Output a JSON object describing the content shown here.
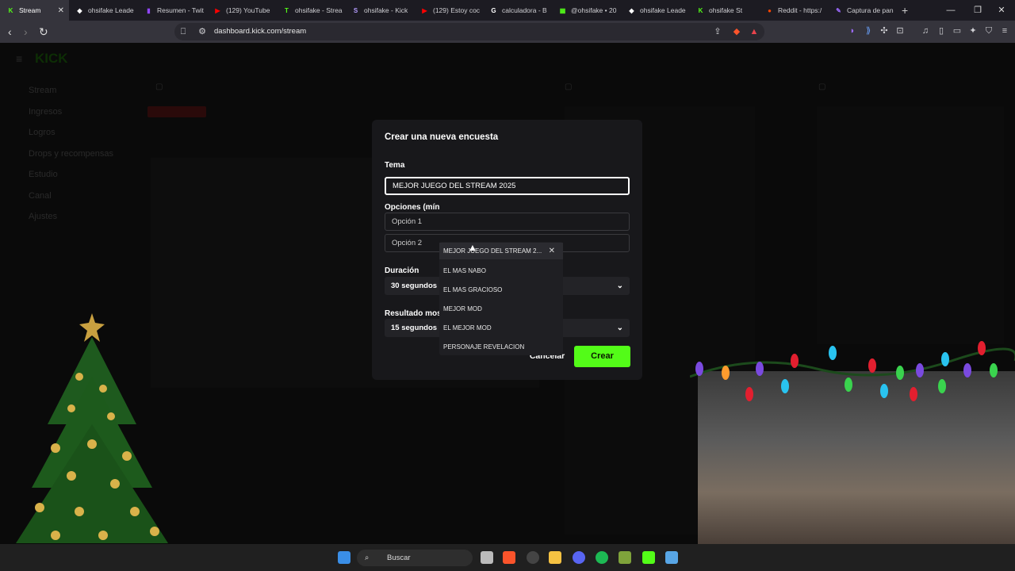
{
  "browser": {
    "tabs": [
      {
        "label": "Stream",
        "color": "#53fc18",
        "glyph": "K",
        "active": true
      },
      {
        "label": "ohsifake Leade",
        "color": "#ffffff",
        "glyph": "◆"
      },
      {
        "label": "Resumen - Twit",
        "color": "#9146ff",
        "glyph": "▮"
      },
      {
        "label": "(129) YouTube",
        "color": "#ff0000",
        "glyph": "▶"
      },
      {
        "label": "ohsifake - Strea",
        "color": "#53fc18",
        "glyph": "T"
      },
      {
        "label": "ohsifake - Kick",
        "color": "#b49cff",
        "glyph": "S"
      },
      {
        "label": "(129) Estoy coc",
        "color": "#ff0000",
        "glyph": "▶"
      },
      {
        "label": "calculadora - B",
        "color": "#ffffff",
        "glyph": "G"
      },
      {
        "label": "@ohsifake • 20",
        "color": "#53fc18",
        "glyph": "▦"
      },
      {
        "label": "ohsifake Leade",
        "color": "#ffffff",
        "glyph": "◆"
      },
      {
        "label": "ohsifake St",
        "color": "#53fc18",
        "glyph": "K"
      },
      {
        "label": "Reddit - https:/",
        "color": "#ff4500",
        "glyph": "●"
      },
      {
        "label": "Captura de pan",
        "color": "#9d6bff",
        "glyph": "✎"
      }
    ],
    "url": "dashboard.kick.com/stream"
  },
  "dialog": {
    "title": "Crear una nueva encuesta",
    "topic_label": "Tema",
    "topic_value": "MEJOR JUEGO DEL STREAM 2025",
    "options_label": "Opciones (mín",
    "option1_placeholder": "Opción 1",
    "option2_placeholder": "Opción 2",
    "duration_label": "Duración",
    "duration_value": "30 segundos",
    "result_label": "Resultado mos",
    "result_value": "15 segundos",
    "cancel_label": "Cancelar",
    "create_label": "Crear"
  },
  "autocomplete": {
    "items": [
      "MEJOR JUEGO DEL STREAM 2...",
      "EL MAS NABO",
      "EL MAS GRACIOSO",
      "MEJOR MOD",
      "EL MEJOR MOD",
      "PERSONAJE REVELACION"
    ]
  },
  "sidebar": {
    "items": [
      "Stream",
      "Ingresos",
      "Logros",
      "Drops y recompensas",
      "Estudio",
      "Canal",
      "Ajustes"
    ]
  },
  "taskbar": {
    "search_placeholder": "Buscar"
  },
  "colors": {
    "accent": "#53fc18",
    "dialog_bg": "#18181b",
    "page_bg": "#0a0a0a"
  }
}
